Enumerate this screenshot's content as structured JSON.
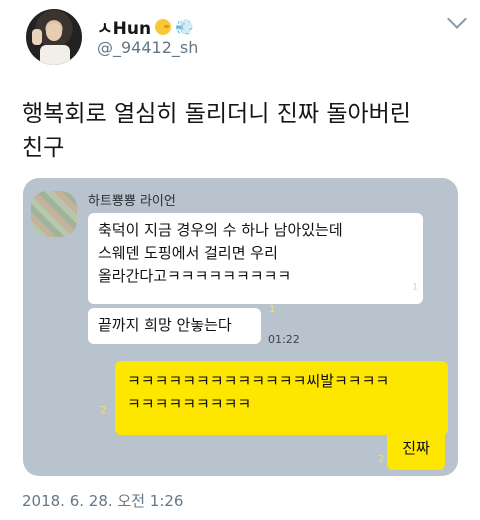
{
  "header": {
    "display_name": "ㅅHun",
    "emoji_1": "chick-emoji",
    "emoji_2": "wind-emoji",
    "handle": "@_94412_sh"
  },
  "tweet": {
    "text_line1": "행복회로 열심히 돌리더니 진짜 돌아버린",
    "text_line2": "친구",
    "timestamp": "2018. 6. 28. 오전 1:26"
  },
  "chat": {
    "friend_name": "하트뿅뿅 라이언",
    "messages": [
      {
        "side": "left",
        "text": "축덕이 지금 경우의 수 하나 남아있는데\n스웨덴 도핑에서 걸리면 우리\n올라간다고ㅋㅋㅋㅋㅋㅋㅋㅋㅋ",
        "unread": "1"
      },
      {
        "side": "left",
        "text": "끝까지 희망 안놓는다",
        "unread": "1",
        "time": "01:22"
      },
      {
        "side": "right",
        "text": "ㅋㅋㅋㅋㅋㅋㅋㅋㅋㅋㅋㅋㅋ씨발ㅋㅋㅋㅋ\nㅋㅋㅋㅋㅋㅋㅋㅋㅋ",
        "unread": "2"
      },
      {
        "side": "right",
        "text": "진짜",
        "unread": "2"
      }
    ]
  },
  "colors": {
    "chat_bg": "#b9c3ce",
    "my_bubble": "#fde600",
    "friend_bubble": "#ffffff",
    "unread_marker": "#f3e06c"
  }
}
